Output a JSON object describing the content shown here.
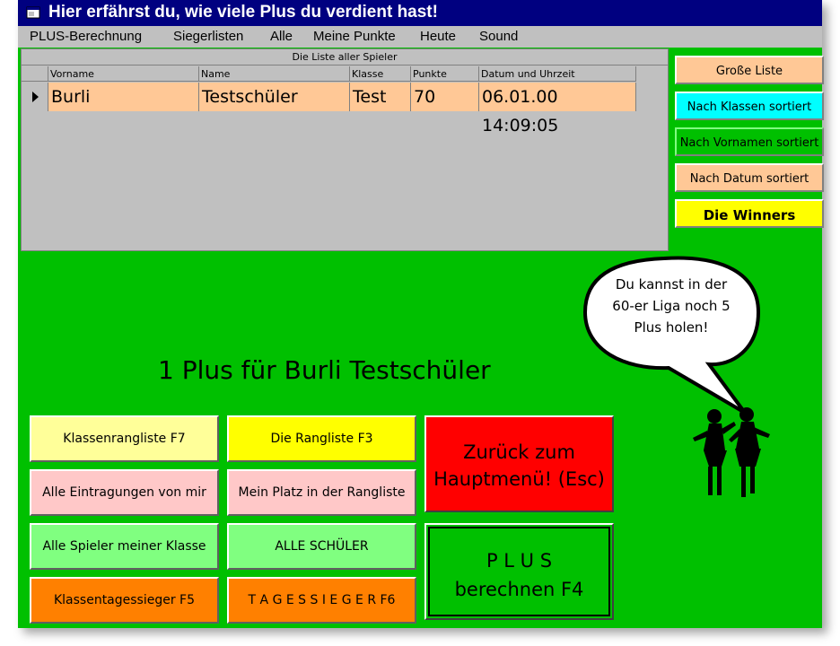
{
  "window": {
    "title": "Hier erfährst du, wie viele Plus du verdient hast!"
  },
  "menu": [
    "PLUS-Berechnung",
    "Siegerlisten",
    "Alle",
    "Meine Punkte",
    "Heute",
    "Sound"
  ],
  "table": {
    "caption": "Die Liste aller Spieler",
    "columns": [
      "Vorname",
      "Name",
      "Klasse",
      "Punkte",
      "Datum und Uhrzeit"
    ],
    "rows": [
      [
        "Burli",
        "Testschüler",
        "Test",
        "70",
        "06.01.00 14:09:05"
      ]
    ]
  },
  "sort_buttons": [
    "Große Liste",
    "Nach Klassen sortiert",
    "Nach Vornamen sortiert",
    "Nach Datum sortiert",
    "Die Winners"
  ],
  "headline": "1 Plus für Burli Testschüler",
  "speech": {
    "line1": "Du kannst in der",
    "line2": "60-er Liga noch 5",
    "line3": "Plus holen!"
  },
  "buttons": {
    "klassenrangliste": "Klassenrangliste  F7",
    "rangliste": "Die Rangliste  F3",
    "eintragungen": "Alle Eintragungen von mir",
    "mein_platz": "Mein Platz in der Rangliste",
    "spieler_klasse": "Alle Spieler meiner Klasse",
    "alle_schueler": "ALLE SCHÜLER",
    "klassentagessieger": "Klassentagessieger  F5",
    "tagessieger": "T A G E S S I E G E R   F6",
    "zurueck_line1": "Zurück zum",
    "zurueck_line2": "Hauptmenü! (Esc)",
    "plus_line1": "P L U S",
    "plus_line2": "berechnen  F4"
  },
  "colors": {
    "window_bg": "#00c000",
    "titlebar": "#000080",
    "row": "#ffc896",
    "cyan": "#00ffff",
    "yellow": "#ffff00",
    "light_yellow": "#ffff99",
    "pink": "#ffc8c8",
    "light_green": "#80ff80",
    "orange": "#ff8000",
    "peach": "#ffc896",
    "red": "#ff0000"
  },
  "icons": [
    "window-icon",
    "row-selector-arrow-icon",
    "speech-bubble-icon",
    "dancing-girls-icon"
  ]
}
